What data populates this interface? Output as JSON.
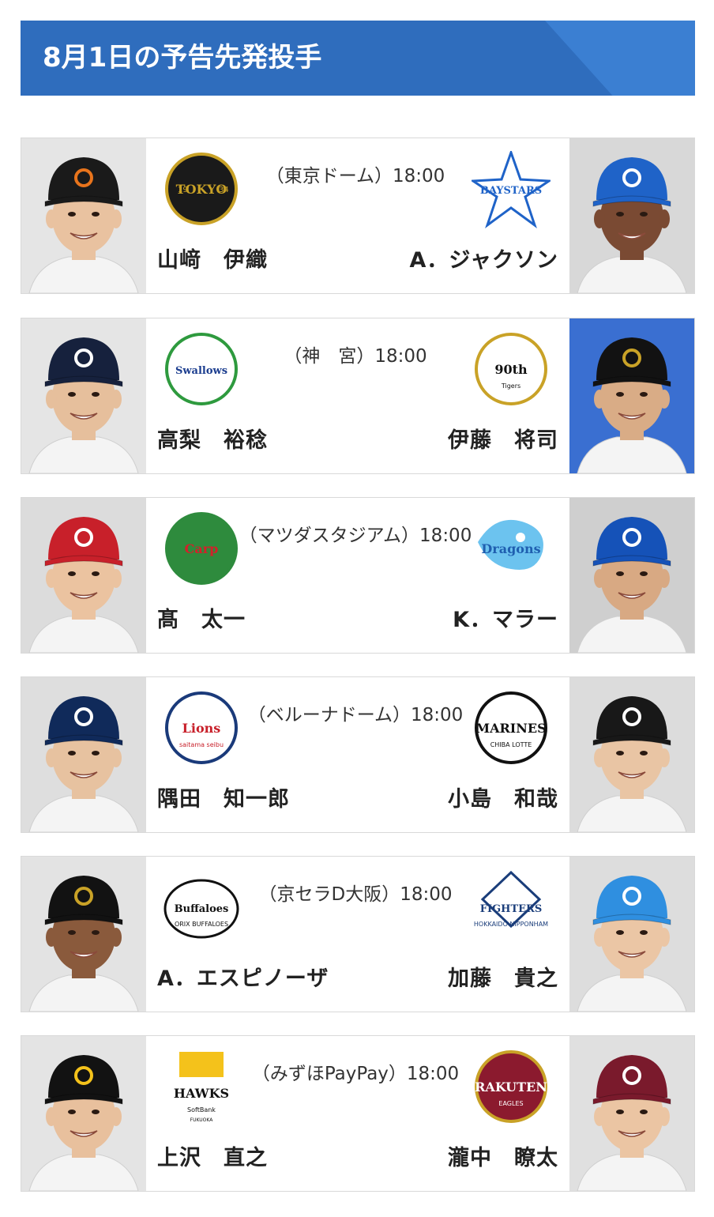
{
  "header": {
    "title": "8月1日の予告先発投手"
  },
  "games": [
    {
      "venue_time": "（東京ドーム）18:00",
      "home": {
        "pitcher": "山﨑　伊織",
        "team_logo": "giants-logo",
        "logo_text": "TOKYO",
        "logo_year_left": "19",
        "logo_year_right": "34",
        "cap_color": "#1a1a1a",
        "cap_mark_color": "#e8741c",
        "bg": "#e5e5e5",
        "skin": "#e9c2a0"
      },
      "away": {
        "pitcher": "A．ジャクソン",
        "team_logo": "baystars-logo",
        "logo_text": "BAYSTARS",
        "cap_color": "#1f63c8",
        "cap_mark_color": "#ffffff",
        "bg": "#d8d8d8",
        "skin": "#7a4a33"
      }
    },
    {
      "venue_time": "（神　宮）18:00",
      "home": {
        "pitcher": "高梨　裕稔",
        "team_logo": "swallows-logo",
        "logo_text": "Swallows",
        "cap_color": "#16213d",
        "cap_mark_color": "#ffffff",
        "bg": "#e5e5e5",
        "skin": "#e6bf9c"
      },
      "away": {
        "pitcher": "伊藤　将司",
        "team_logo": "tigers-90th-logo",
        "logo_text": "90th",
        "logo_subtext": "Tigers",
        "cap_color": "#121212",
        "cap_mark_color": "#c9a227",
        "bg": "#3a6fd1",
        "skin": "#d9ac86"
      }
    },
    {
      "venue_time": "（マツダスタジアム）18:00",
      "home": {
        "pitcher": "髙　太一",
        "team_logo": "carp-logo",
        "logo_text": "Carp",
        "cap_color": "#c8202a",
        "cap_mark_color": "#ffffff",
        "bg": "#dcdcdc",
        "skin": "#ebc3a0"
      },
      "away": {
        "pitcher": "K．マラー",
        "team_logo": "dragons-logo",
        "logo_text": "Dragons",
        "cap_color": "#1552b8",
        "cap_mark_color": "#ffffff",
        "bg": "#cfcfcf",
        "skin": "#d8a983"
      }
    },
    {
      "venue_time": "（ベルーナドーム）18:00",
      "home": {
        "pitcher": "隅田　知一郎",
        "team_logo": "lions-logo",
        "logo_text": "Lions",
        "logo_subtext": "saitama seibu",
        "cap_color": "#102a5a",
        "cap_mark_color": "#ffffff",
        "bg": "#dedede",
        "skin": "#e7c2a0"
      },
      "away": {
        "pitcher": "小島　和哉",
        "team_logo": "marines-logo",
        "logo_text": "MARINES",
        "logo_subtext": "CHIBA LOTTE",
        "cap_color": "#181818",
        "cap_mark_color": "#ffffff",
        "bg": "#dcdcdc",
        "skin": "#e9c5a4"
      }
    },
    {
      "venue_time": "（京セラD大阪）18:00",
      "home": {
        "pitcher": "A．エスピノーザ",
        "team_logo": "buffaloes-logo",
        "logo_text": "Buffaloes",
        "logo_subtext": "ORIX BUFFALOES",
        "cap_color": "#121212",
        "cap_mark_color": "#c9a227",
        "bg": "#e3e3e3",
        "skin": "#8a5a3c"
      },
      "away": {
        "pitcher": "加藤　貴之",
        "team_logo": "fighters-logo",
        "logo_text": "FIGHTERS",
        "logo_subtext": "HOKKAIDO NIPPONHAM",
        "cap_color": "#2f8fe0",
        "cap_mark_color": "#ffffff",
        "bg": "#dddddd",
        "skin": "#ebc6a5"
      }
    },
    {
      "venue_time": "（みずほPayPay）18:00",
      "home": {
        "pitcher": "上沢　直之",
        "team_logo": "hawks-logo",
        "logo_text": "HAWKS",
        "logo_subtext": "SoftBank",
        "logo_fukuoka": "FUKUOKA",
        "cap_color": "#121212",
        "cap_mark_color": "#f4c21b",
        "bg": "#e4e4e4",
        "skin": "#e8c09d"
      },
      "away": {
        "pitcher": "瀧中　瞭太",
        "team_logo": "eagles-logo",
        "logo_text": "RAKUTEN",
        "logo_subtext": "EAGLES",
        "cap_color": "#7a1a2c",
        "cap_mark_color": "#ffffff",
        "bg": "#e0e0e0",
        "skin": "#ebc5a3"
      }
    }
  ]
}
